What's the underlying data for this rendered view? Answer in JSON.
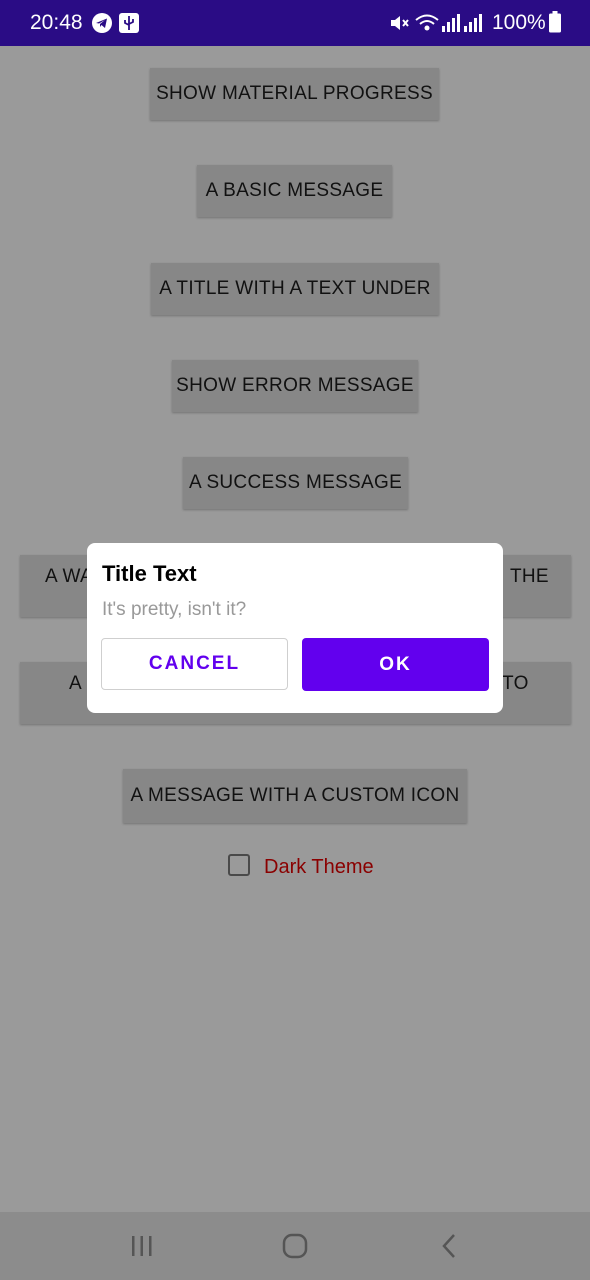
{
  "status_bar": {
    "time": "20:48",
    "icons": [
      "telegram-icon",
      "usb-icon",
      "mute-icon",
      "wifi-icon",
      "signal-icon",
      "signal-icon",
      "battery-icon"
    ],
    "battery": "100%"
  },
  "main": {
    "buttons": [
      {
        "label": "SHOW MATERIAL PROGRESS"
      },
      {
        "label": "A BASIC MESSAGE"
      },
      {
        "label": "A TITLE WITH A TEXT UNDER"
      },
      {
        "label": "SHOW ERROR MESSAGE"
      },
      {
        "label": "A SUCCESS MESSAGE"
      },
      {
        "label_left": "A WA",
        "label_right": "THE"
      },
      {
        "label_left": "A",
        "label_right": "TO"
      },
      {
        "label": "A MESSAGE WITH A CUSTOM ICON"
      }
    ],
    "dark_theme": {
      "label": "Dark Theme",
      "checked": false
    }
  },
  "dialog": {
    "title": "Title Text",
    "message": "It's pretty, isn't it?",
    "cancel_label": "CANCEL",
    "ok_label": "OK"
  },
  "nav_bar": {
    "icons": [
      "recent-apps-icon",
      "home-icon",
      "back-icon"
    ]
  },
  "colors": {
    "status_bar": "#2a0c85",
    "accent": "#6200ee",
    "dark_theme_label": "#8a0000"
  }
}
